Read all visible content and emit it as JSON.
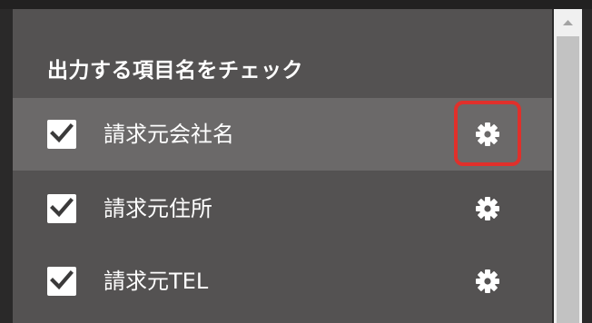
{
  "panel": {
    "title": "出力する項目名をチェック",
    "items": [
      {
        "label": "請求元会社名",
        "checked": true,
        "selected": true,
        "gear_highlighted": true,
        "icon": "gear-icon"
      },
      {
        "label": "請求元住所",
        "checked": true,
        "selected": false,
        "gear_highlighted": false,
        "icon": "gear-icon"
      },
      {
        "label": "請求元TEL",
        "checked": true,
        "selected": false,
        "gear_highlighted": false,
        "icon": "gear-icon"
      }
    ]
  },
  "colors": {
    "panel_bg": "#545252",
    "selected_row_bg": "#6b6969",
    "highlight_border": "#e0302b",
    "text": "#ffffff"
  }
}
